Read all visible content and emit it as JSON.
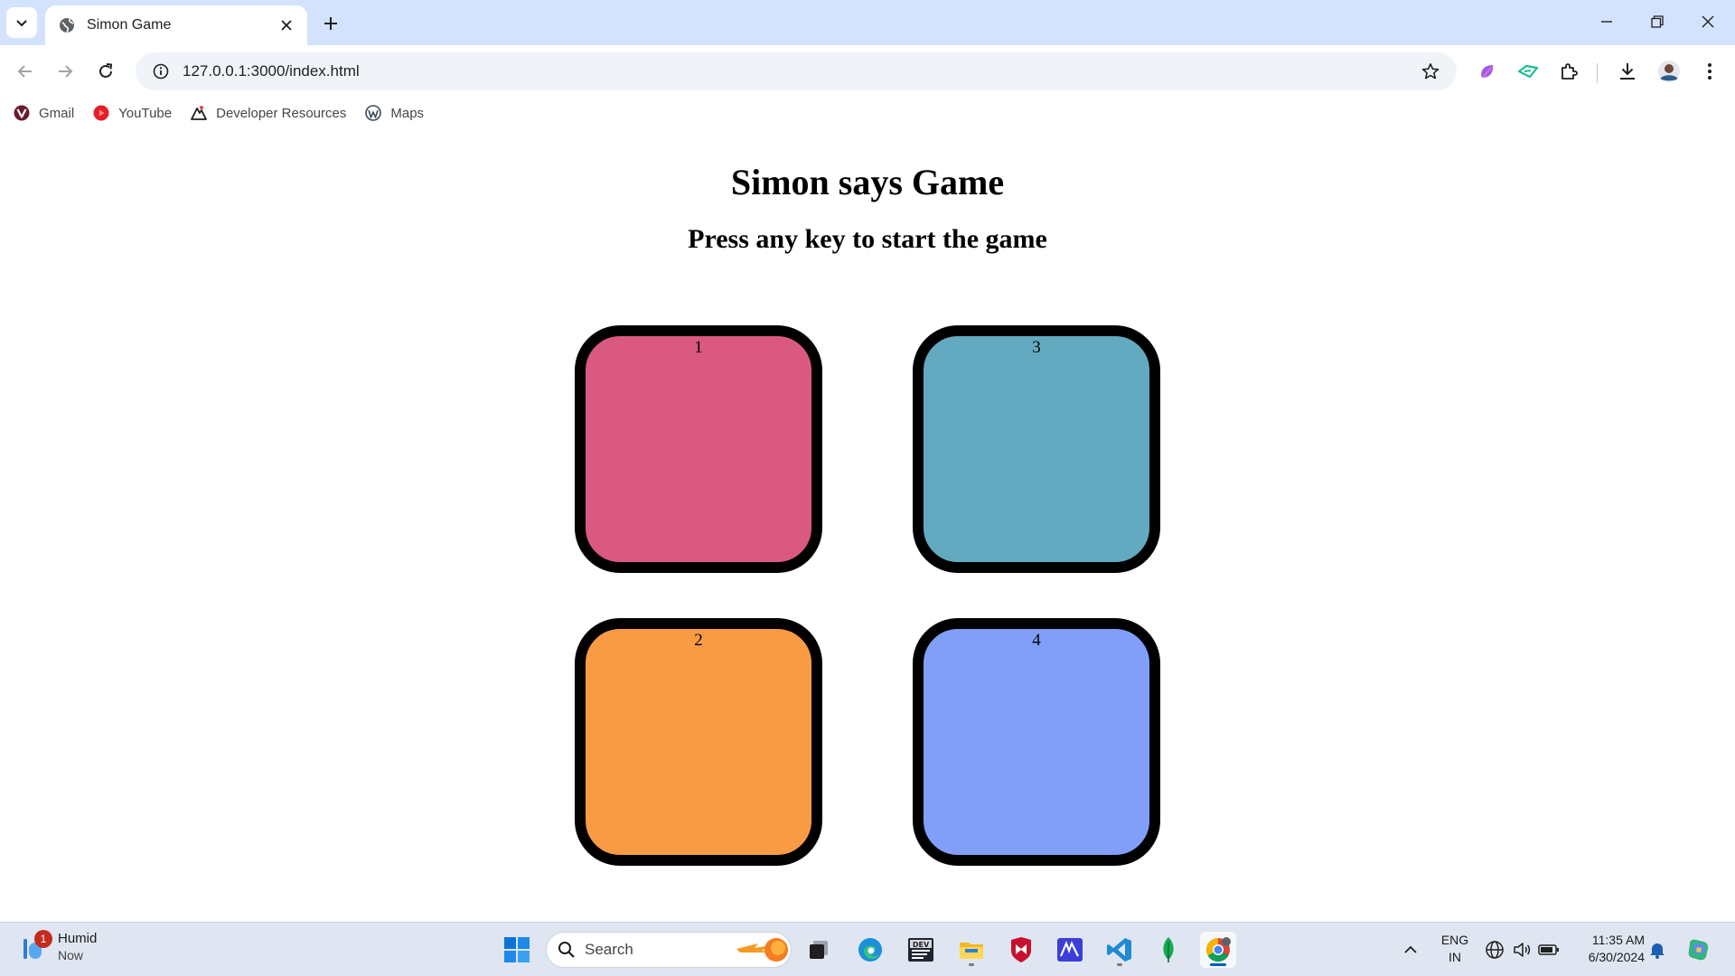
{
  "browser": {
    "tab_title": "Simon Game",
    "url": "127.0.0.1:3000/index.html",
    "bookmarks": [
      {
        "label": "Gmail",
        "icon": "vivaldi-icon"
      },
      {
        "label": "YouTube",
        "icon": "youtube-icon"
      },
      {
        "label": "Developer Resources",
        "icon": "developer-resources-icon"
      },
      {
        "label": "Maps",
        "icon": "wordpress-icon"
      }
    ]
  },
  "page": {
    "heading": "Simon says Game",
    "subheading": "Press any key to start the game",
    "buttons": [
      {
        "label": "1",
        "color": "#d95980"
      },
      {
        "label": "2",
        "color": "#f99b45"
      },
      {
        "label": "3",
        "color": "#63aac0"
      },
      {
        "label": "4",
        "color": "#819ff9"
      }
    ]
  },
  "taskbar": {
    "weather": {
      "title": "Humid",
      "subtitle": "Now",
      "badge": "1"
    },
    "search_placeholder": "Search",
    "language": {
      "line1": "ENG",
      "line2": "IN"
    },
    "clock": {
      "time": "11:35 AM",
      "date": "6/30/2024"
    }
  },
  "colors": {
    "chrome_frame": "#d3e3fd",
    "omnibox": "#f0f4f9",
    "taskbar": "#dfe6f1",
    "accent": "#005fb8"
  }
}
